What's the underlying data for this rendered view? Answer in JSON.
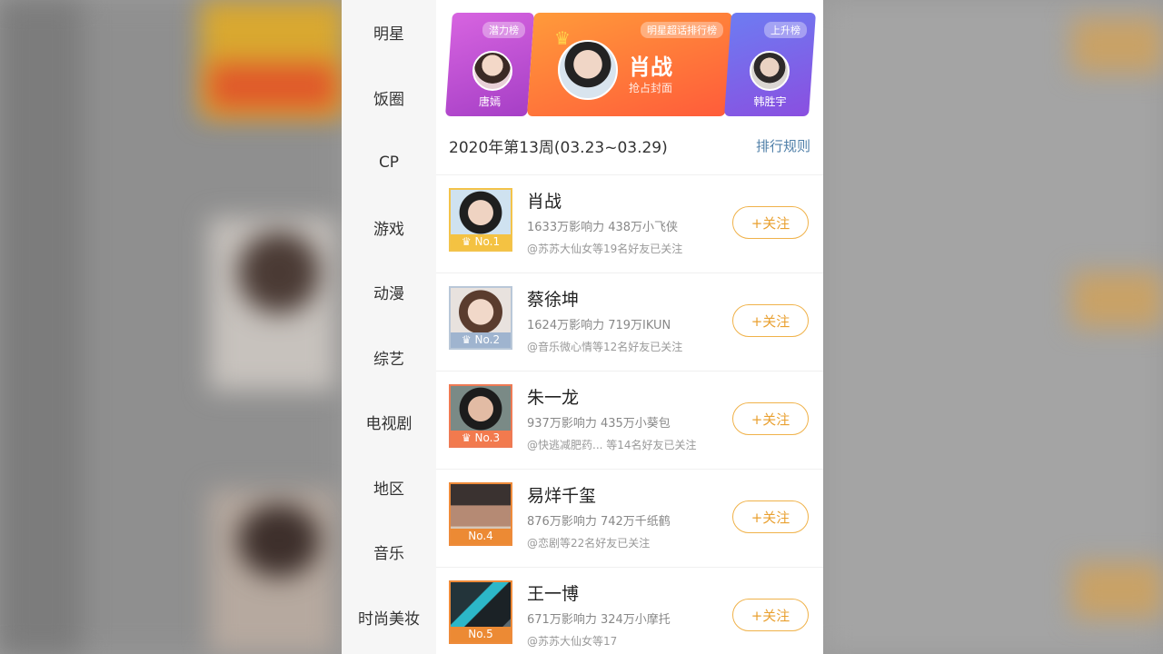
{
  "sidebar": {
    "items": [
      {
        "label": "明星"
      },
      {
        "label": "饭圈"
      },
      {
        "label": "CP"
      },
      {
        "label": "游戏"
      },
      {
        "label": "动漫"
      },
      {
        "label": "综艺"
      },
      {
        "label": "电视剧"
      },
      {
        "label": "地区"
      },
      {
        "label": "音乐"
      },
      {
        "label": "时尚美妆"
      }
    ]
  },
  "banner": {
    "left": {
      "tag": "潜力榜",
      "name": "唐嫣"
    },
    "mid": {
      "tag": "明星超话排行榜",
      "name": "肖战",
      "sub": "抢占封面"
    },
    "right": {
      "tag": "上升榜",
      "name": "韩胜宇"
    }
  },
  "week_label": "2020年第13周(03.23~03.29)",
  "rules_label": "排行规则",
  "follow_label": "+关注",
  "ranking": [
    {
      "rank": "No.1",
      "name": "肖战",
      "stats": "1633万影响力 438万小飞侠",
      "friends": "@苏苏大仙女等19名好友已关注"
    },
    {
      "rank": "No.2",
      "name": "蔡徐坤",
      "stats": "1624万影响力 719万IKUN",
      "friends": "@音乐微心情等12名好友已关注"
    },
    {
      "rank": "No.3",
      "name": "朱一龙",
      "stats": "937万影响力 435万小葵包",
      "friends": "@快逃减肥药... 等14名好友已关注"
    },
    {
      "rank": "No.4",
      "name": "易烊千玺",
      "stats": "876万影响力 742万千纸鹤",
      "friends": "@恋剧等22名好友已关注"
    },
    {
      "rank": "No.5",
      "name": "王一博",
      "stats": "671万影响力 324万小摩托",
      "friends": "@苏苏大仙女等17"
    }
  ],
  "colors": {
    "accent_orange": "#ff7a3a",
    "follow_border": "#f0b24a",
    "rules_blue": "#4f7fa8"
  }
}
